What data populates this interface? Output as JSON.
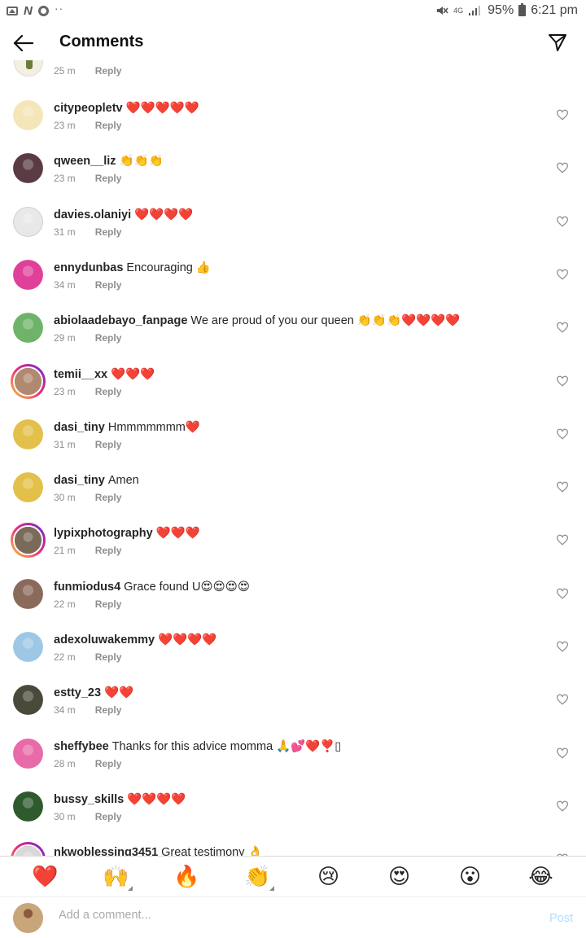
{
  "status_bar": {
    "network": "4G",
    "battery": "95%",
    "time": "6:21 pm"
  },
  "header": {
    "title": "Comments"
  },
  "partial_comment": {
    "time": "25 m",
    "reply_label": "Reply"
  },
  "comments": [
    {
      "username": "citypeopletv",
      "text": "❤️❤️❤️❤️❤️",
      "time": "23 m",
      "reply_label": "Reply",
      "avatar_color": "#f4e6b8",
      "story": false
    },
    {
      "username": "qween__liz",
      "text": "👏👏👏",
      "time": "23 m",
      "reply_label": "Reply",
      "avatar_color": "#5a3b44",
      "story": false
    },
    {
      "username": "davies.olaniyi",
      "text": "❤️❤️❤️❤️",
      "time": "31 m",
      "reply_label": "Reply",
      "avatar_color": "#e8e8e8",
      "story": false
    },
    {
      "username": "ennydunbas",
      "text": "Encouraging 👍",
      "time": "34 m",
      "reply_label": "Reply",
      "avatar_color": "#e0409a",
      "story": false
    },
    {
      "username": "abiolaadebayo_fanpage",
      "text": "We are proud of you our queen 👏👏👏❤️❤️❤️❤️",
      "time": "29 m",
      "reply_label": "Reply",
      "avatar_color": "#6fb36a",
      "story": false
    },
    {
      "username": "temii__xx",
      "text": "❤️❤️❤️",
      "time": "23 m",
      "reply_label": "Reply",
      "avatar_color": "#b08a70",
      "story": true
    },
    {
      "username": "dasi_tiny",
      "text": "Hmmmmmmm❤️",
      "time": "31 m",
      "reply_label": "Reply",
      "avatar_color": "#e2c04a",
      "story": false
    },
    {
      "username": "dasi_tiny",
      "text": "Amen",
      "time": "30 m",
      "reply_label": "Reply",
      "avatar_color": "#e2c04a",
      "story": false
    },
    {
      "username": "lypixphotography",
      "text": "❤️❤️❤️",
      "time": "21 m",
      "reply_label": "Reply",
      "avatar_color": "#7a6a5a",
      "story": true
    },
    {
      "username": "funmiodus4",
      "text": "Grace found U😍😍😍😍",
      "time": "22 m",
      "reply_label": "Reply",
      "avatar_color": "#8a6a5a",
      "story": false
    },
    {
      "username": "adexoluwakemmy",
      "text": "❤️❤️❤️❤️",
      "time": "22 m",
      "reply_label": "Reply",
      "avatar_color": "#9ec7e6",
      "story": false
    },
    {
      "username": "estty_23",
      "text": "❤️❤️",
      "time": "34 m",
      "reply_label": "Reply",
      "avatar_color": "#4a4a3a",
      "story": false
    },
    {
      "username": "sheffybee",
      "text": "Thanks for this advice momma 🙏💕❤️❣️▯",
      "time": "28 m",
      "reply_label": "Reply",
      "avatar_color": "#e86aa8",
      "story": false
    },
    {
      "username": "bussy_skills",
      "text": "❤️❤️❤️❤️",
      "time": "30 m",
      "reply_label": "Reply",
      "avatar_color": "#2e5a2e",
      "story": false
    },
    {
      "username": "nkwoblessing3451",
      "text": "Great testimony 👌",
      "time": "",
      "reply_label": "",
      "avatar_color": "#d8d8d8",
      "story": true
    }
  ],
  "emoji_bar": [
    "❤️",
    "🙌",
    "🔥",
    "👏",
    "😢",
    "😍",
    "😮",
    "😂"
  ],
  "composer": {
    "placeholder": "Add a comment...",
    "post_label": "Post",
    "avatar_color": "#c9a57a"
  },
  "colors": {
    "heart_red": "#ed4956",
    "post_blue": "#b3dbff",
    "muted_text": "#8e8e8e"
  }
}
